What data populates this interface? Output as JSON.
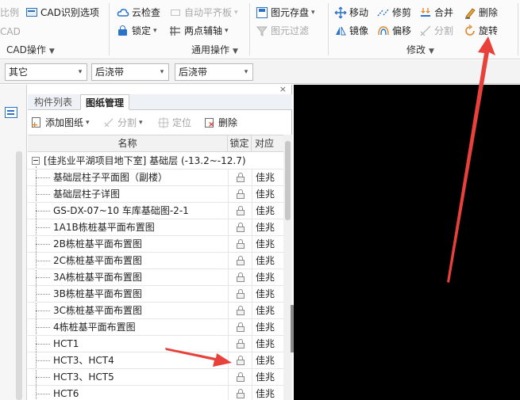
{
  "ribbon": {
    "cad_group": {
      "item_partial": "比例",
      "item_partial2": "CAD",
      "cad_recognize_label": "CAD识别选项",
      "label": "CAD操作"
    },
    "common_group": {
      "cloud_check_label": "云检查",
      "auto_align_label": "自动平齐板",
      "lock_label": "锁定",
      "two_point_axis_label": "两点辅轴",
      "label": "通用操作"
    },
    "storage_group": {
      "store_label": "图元存盘",
      "filter_label": "图元过滤"
    },
    "modify_group": {
      "move_label": "移动",
      "trim_label": "修剪",
      "merge_label": "合并",
      "delete_label": "删除",
      "mirror_label": "镜像",
      "offset_label": "偏移",
      "split_label": "分割",
      "rotate_label": "旋转",
      "label": "修改"
    }
  },
  "selectors": {
    "first": "其它",
    "second": "后浇带",
    "third": "后浇带"
  },
  "panel": {
    "close_glyph": "×",
    "tabs": [
      "构件列表",
      "图纸管理"
    ],
    "toolbar": {
      "add_drawing": "添加图纸",
      "split": "分割",
      "locate": "定位",
      "delete": "删除"
    },
    "columns": {
      "name": "名称",
      "lock": "锁定",
      "assoc": "对应"
    },
    "group_row": "[佳兆业平湖项目地下室] 基础层 (-13.2~-12.7)",
    "rows": [
      {
        "name": "基础层柱子平面图（副楼）",
        "assoc": "佳兆"
      },
      {
        "name": "基础层柱子详图",
        "assoc": "佳兆"
      },
      {
        "name": "GS-DX-07~10 车库基础图-2-1",
        "assoc": "佳兆"
      },
      {
        "name": "1A1B栋桩基平面布置图",
        "assoc": "佳兆"
      },
      {
        "name": "2B栋桩基平面布置图",
        "assoc": "佳兆"
      },
      {
        "name": "2C栋桩基平面布置图",
        "assoc": "佳兆"
      },
      {
        "name": "3A栋桩基平面布置图",
        "assoc": "佳兆"
      },
      {
        "name": "3B栋桩基平面布置图",
        "assoc": "佳兆"
      },
      {
        "name": "3C栋桩基平面布置图",
        "assoc": "佳兆"
      },
      {
        "name": "4栋桩基平面布置图",
        "assoc": "佳兆"
      },
      {
        "name": "HCT1",
        "assoc": "佳兆"
      },
      {
        "name": "HCT3、HCT4",
        "assoc": "佳兆"
      },
      {
        "name": "HCT3、HCT5",
        "assoc": "佳兆"
      },
      {
        "name": "HCT6",
        "assoc": "佳兆"
      }
    ]
  },
  "annotations": {
    "arrow_color": "#e8403a"
  }
}
